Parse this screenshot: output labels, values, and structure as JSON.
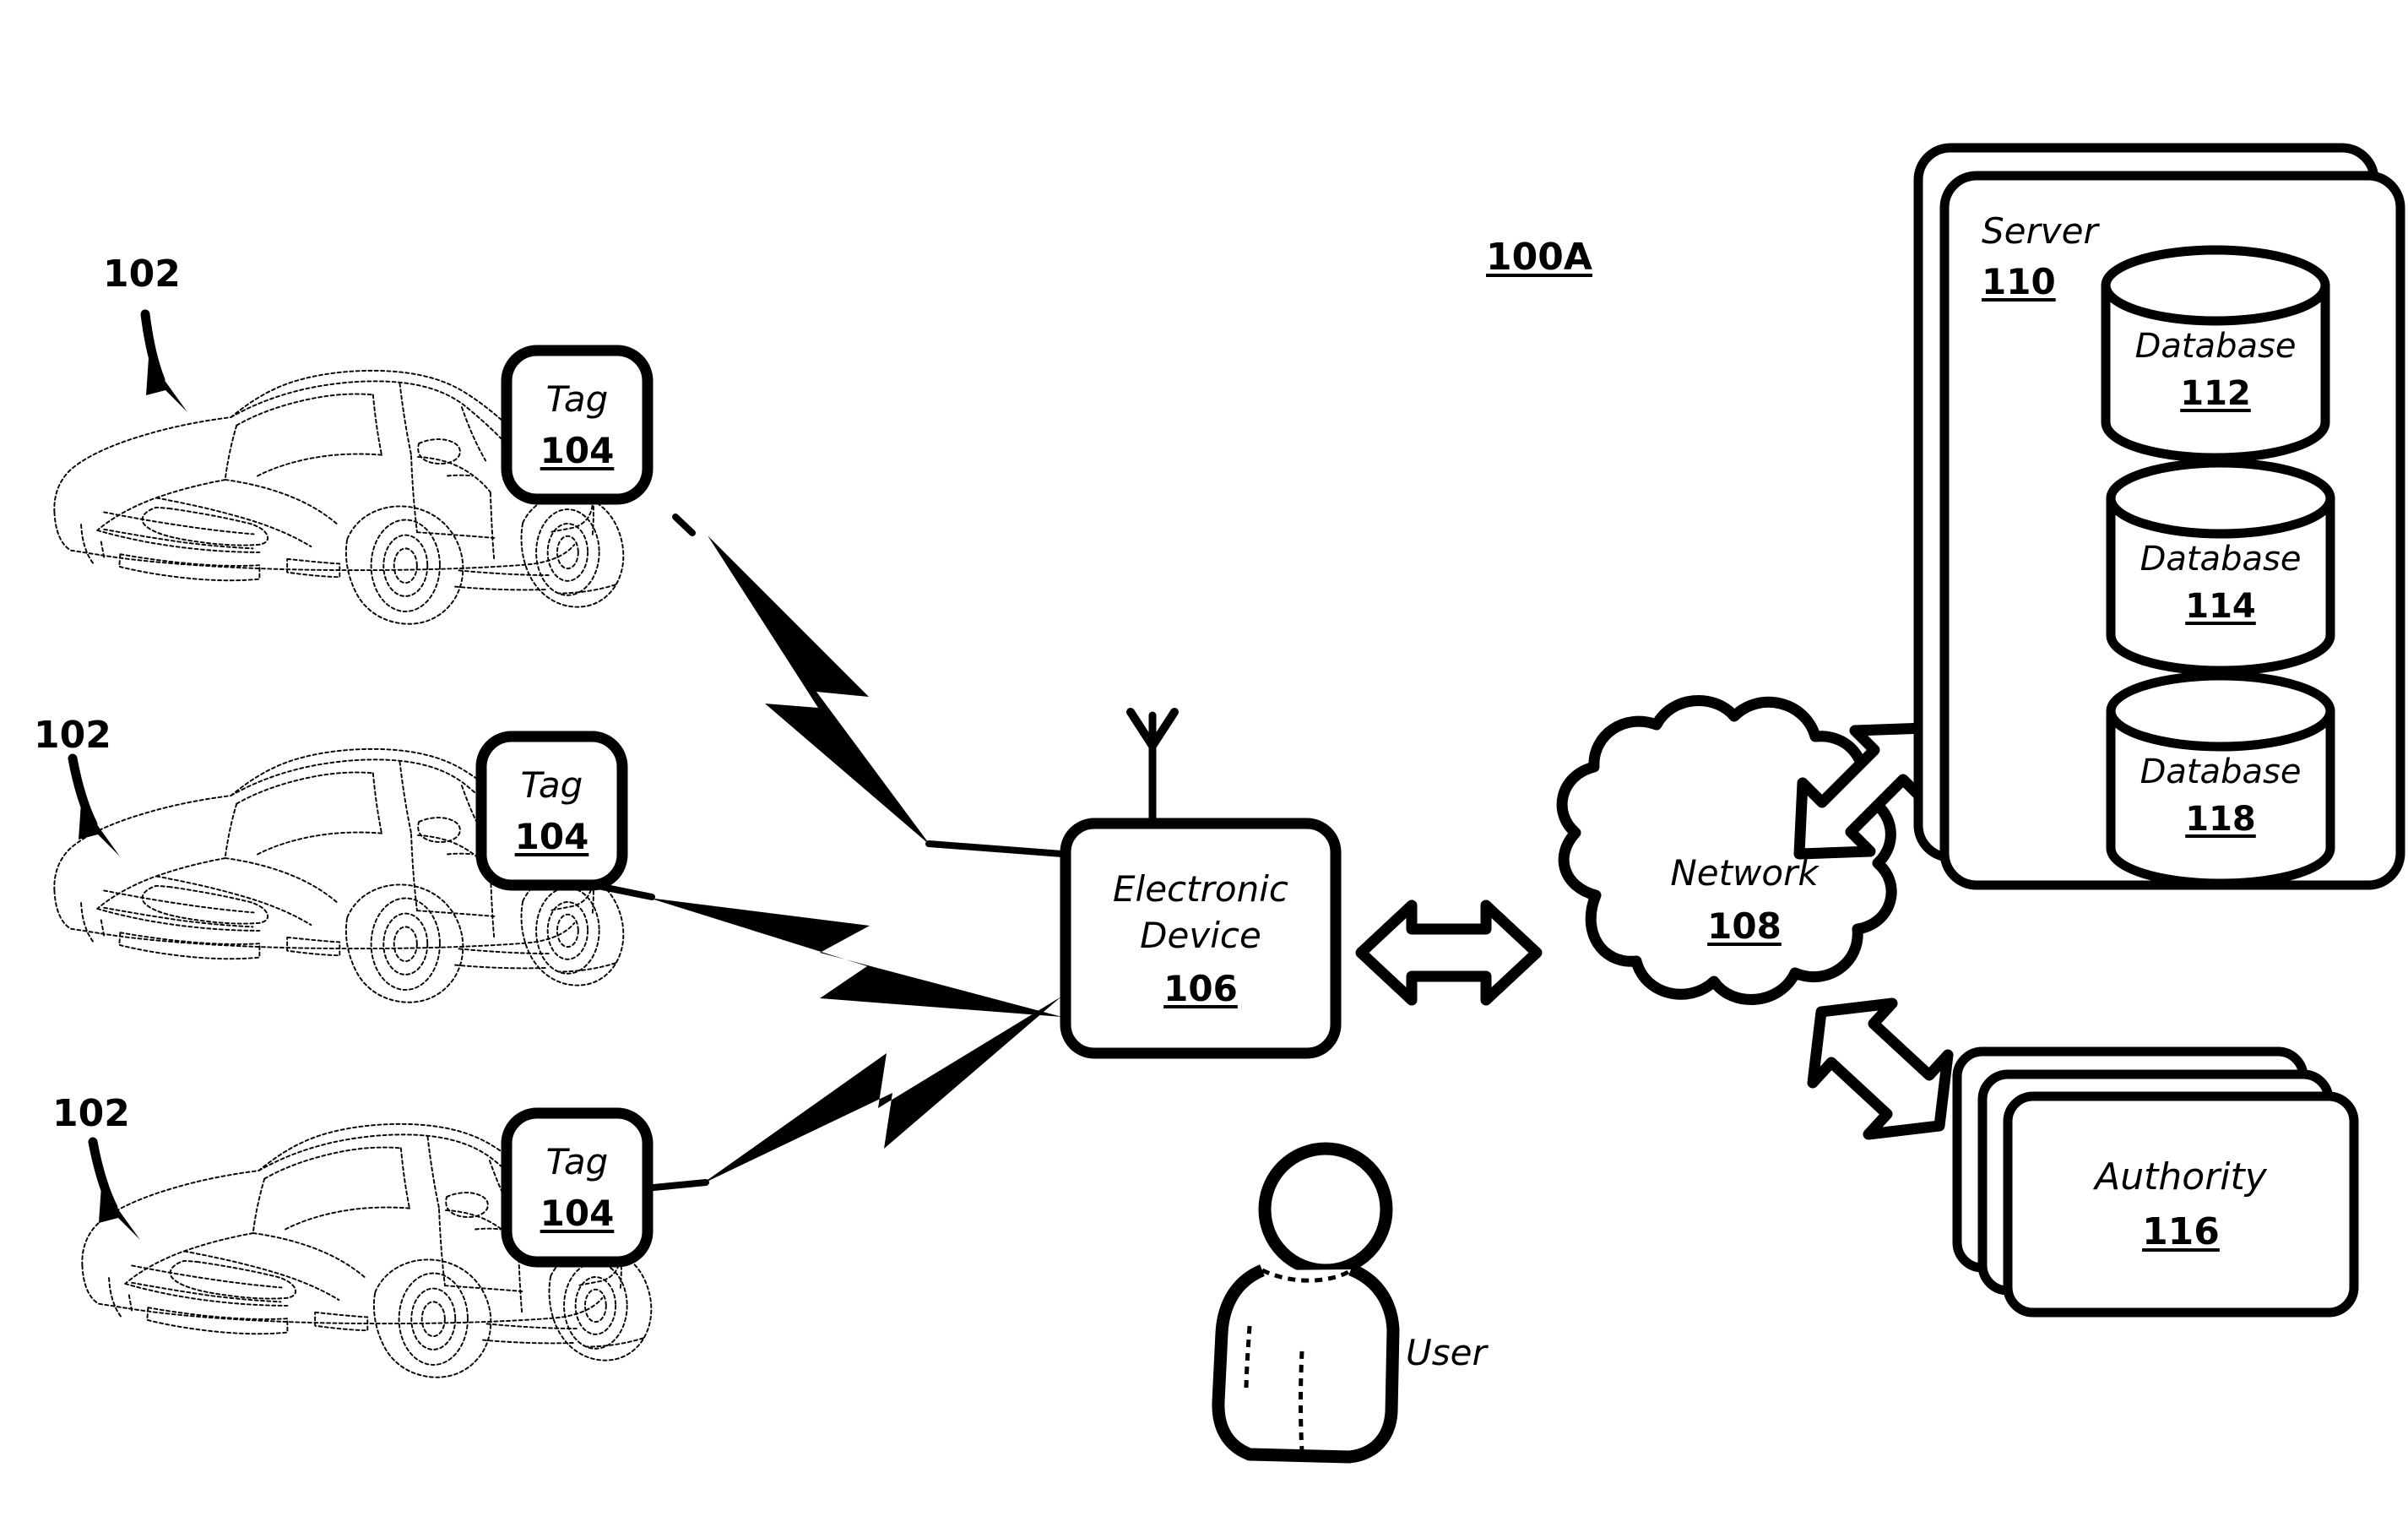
{
  "figure": {
    "label": "100A",
    "type": "patent-system-diagram",
    "background": "#ffffff",
    "stroke": "#000000"
  },
  "vehicles": [
    {
      "ref": "102",
      "name": "vehicle-top",
      "tag": {
        "title": "Tag",
        "ref": "104"
      }
    },
    {
      "ref": "102",
      "name": "vehicle-middle",
      "tag": {
        "title": "Tag",
        "ref": "104"
      }
    },
    {
      "ref": "102",
      "name": "vehicle-bottom",
      "tag": {
        "title": "Tag",
        "ref": "104"
      }
    }
  ],
  "electronic_device": {
    "title_line1": "Electronic",
    "title_line2": "Device",
    "ref": "106",
    "antenna": "antenna-icon"
  },
  "user": {
    "label": "User"
  },
  "network": {
    "title": "Network",
    "ref": "108"
  },
  "server": {
    "title": "Server",
    "ref": "110",
    "databases": [
      {
        "title": "Database",
        "ref": "112"
      },
      {
        "title": "Database",
        "ref": "114"
      },
      {
        "title": "Database",
        "ref": "118"
      }
    ]
  },
  "authority": {
    "title": "Authority",
    "ref": "116"
  },
  "connectors": {
    "wireless_links": [
      {
        "name": "lightning-bolt-top",
        "from": "vehicle-top-tag",
        "to": "electronic-device"
      },
      {
        "name": "lightning-bolt-middle",
        "from": "vehicle-middle-tag",
        "to": "electronic-device"
      },
      {
        "name": "lightning-bolt-bottom",
        "from": "vehicle-bottom-tag",
        "to": "electronic-device"
      }
    ],
    "bidirectional_arrows": [
      {
        "name": "arrow-device-network",
        "orientation": "horizontal"
      },
      {
        "name": "arrow-network-server",
        "orientation": "diagonal-up-right"
      },
      {
        "name": "arrow-network-authority",
        "orientation": "diagonal-down-right"
      }
    ],
    "callout_arrows": [
      {
        "name": "callout-102-top"
      },
      {
        "name": "callout-102-middle"
      },
      {
        "name": "callout-102-bottom"
      }
    ]
  }
}
